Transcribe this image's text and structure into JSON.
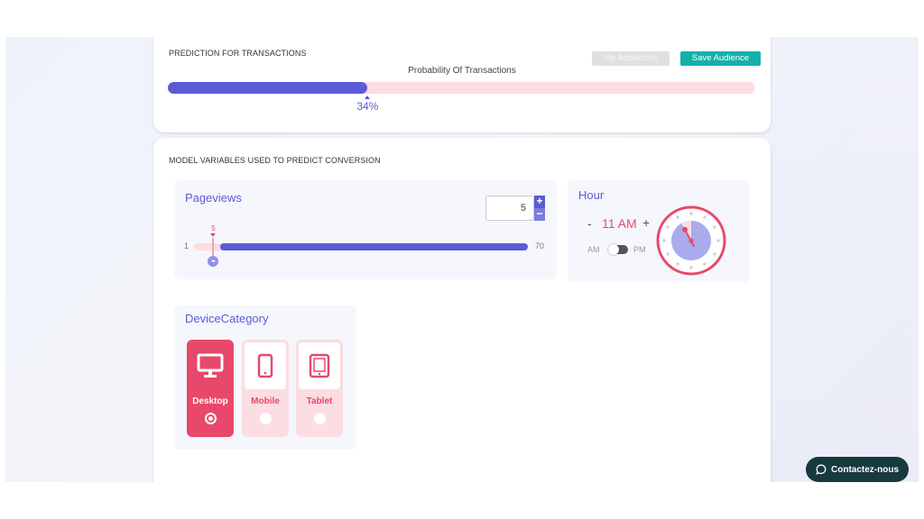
{
  "prediction": {
    "title": "PREDICTION FOR TRANSACTIONS",
    "my_audiences_label": "My Audiences",
    "save_audience_label": "Save Audience",
    "probability_label": "Probability Of Transactions",
    "probability_text": "34%",
    "probability_value": 0.34
  },
  "model": {
    "title": "MODEL VARIABLES USED TO PREDICT CONVERSION",
    "pageviews": {
      "title": "Pageviews",
      "input_value": "5",
      "increment": "+",
      "decrement": "−",
      "min_label": "1",
      "max_label": "70",
      "slider_value_label": "5",
      "knob_text": "◂▸",
      "min": 1,
      "max": 70,
      "value": 5
    },
    "hour": {
      "title": "Hour",
      "decrement": "-",
      "value": "11 AM",
      "increment": "+",
      "am_label": "AM",
      "pm_label": "PM",
      "hour_value": 11,
      "period": "AM"
    },
    "device": {
      "title": "DeviceCategory",
      "options": [
        {
          "label": "Desktop",
          "icon": "desktop-icon",
          "selected": true
        },
        {
          "label": "Mobile",
          "icon": "mobile-icon",
          "selected": false
        },
        {
          "label": "Tablet",
          "icon": "tablet-icon",
          "selected": false
        }
      ]
    }
  },
  "chat": {
    "label": "Contactez-nous",
    "icon": "chat-icon"
  },
  "colors": {
    "accent": "#5b5bd6",
    "pink": "#e8486a",
    "pink_light": "#fbdde2",
    "teal": "#16b0ac",
    "chat_bg": "#173a3e"
  }
}
